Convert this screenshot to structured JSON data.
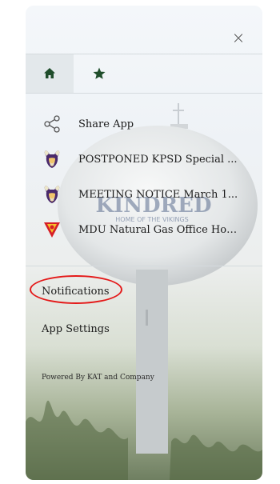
{
  "panel": {
    "close_glyph": "×"
  },
  "tabs": [
    {
      "name": "home",
      "icon": "home-icon",
      "color": "#1f4d2b"
    },
    {
      "name": "favorites",
      "icon": "star-icon",
      "color": "#1f4d2b"
    }
  ],
  "menu": {
    "items": [
      {
        "label": "Share App",
        "icon": "share-icon"
      },
      {
        "label": "POSTPONED KPSD Special ...",
        "icon": "viking-logo-icon"
      },
      {
        "label": "MEETING NOTICE March 1...",
        "icon": "viking-logo-icon"
      },
      {
        "label": "MDU Natural Gas Office Hou...",
        "icon": "mdu-logo-icon"
      }
    ],
    "notifications_label": "Notifications",
    "settings_label": "App Settings",
    "powered_by": "Powered By KAT and Company"
  },
  "background": {
    "tower_text": "KINDRED",
    "tower_subtext": "HOME OF THE VIKINGS"
  },
  "colors": {
    "accent": "#1f4d2b",
    "highlight": "#e41a1a"
  }
}
